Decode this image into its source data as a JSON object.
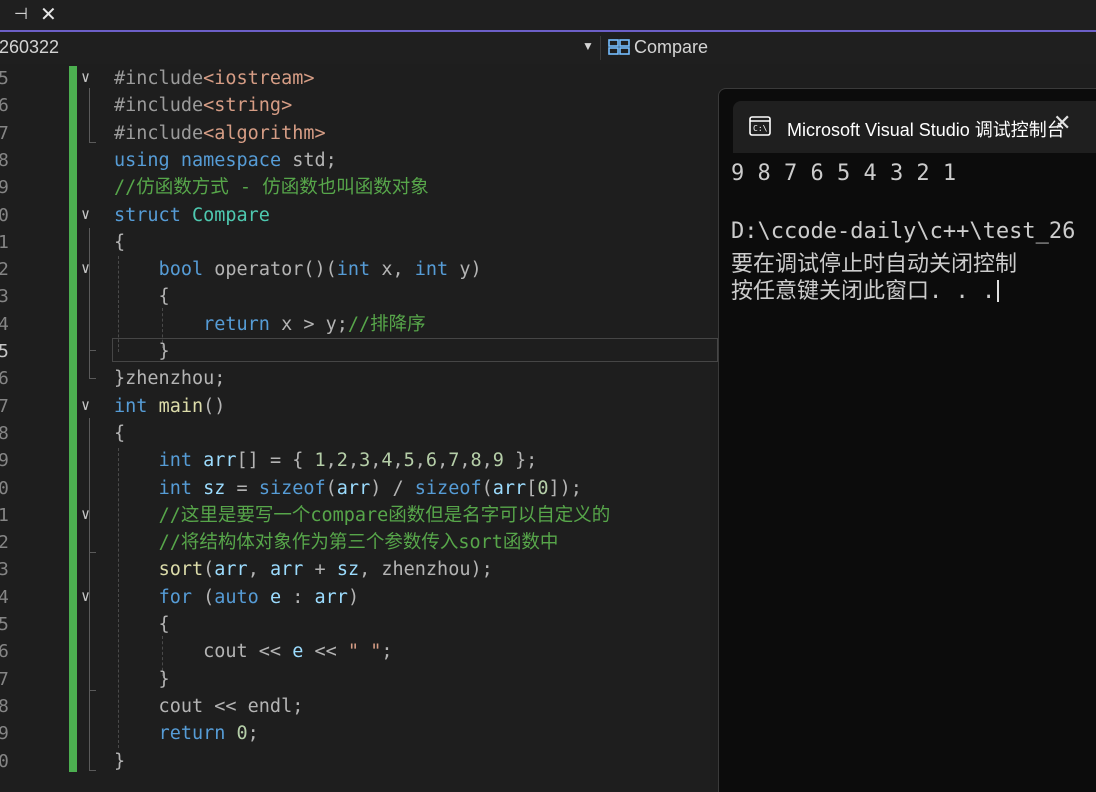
{
  "tabbar": {
    "pin_icon": "pin-icon",
    "close_icon": "close-icon"
  },
  "nav": {
    "left_text": "260322",
    "right_text": "Compare"
  },
  "lines": [
    {
      "n": "5",
      "parts": [
        [
          "pp",
          "#include"
        ],
        [
          "str",
          "<iostream>"
        ]
      ]
    },
    {
      "n": "6",
      "parts": [
        [
          "pp",
          "#include"
        ],
        [
          "str",
          "<string>"
        ]
      ]
    },
    {
      "n": "7",
      "parts": [
        [
          "pp",
          "#include"
        ],
        [
          "str",
          "<algorithm>"
        ]
      ]
    },
    {
      "n": "8",
      "parts": [
        [
          "kw",
          "using"
        ],
        [
          "op",
          " "
        ],
        [
          "kw",
          "namespace"
        ],
        [
          "op",
          " std;"
        ]
      ]
    },
    {
      "n": "9",
      "parts": [
        [
          "cm",
          "//仿函数方式 - 仿函数也叫函数对象"
        ]
      ]
    },
    {
      "n": "0",
      "parts": [
        [
          "kw",
          "struct"
        ],
        [
          "op",
          " "
        ],
        [
          "ty",
          "Compare"
        ]
      ]
    },
    {
      "n": "1",
      "parts": [
        [
          "op",
          "{"
        ]
      ]
    },
    {
      "n": "2",
      "parts": [
        [
          "op",
          "    "
        ],
        [
          "kw",
          "bool"
        ],
        [
          "op",
          " operator()("
        ],
        [
          "kw",
          "int"
        ],
        [
          "op",
          " x, "
        ],
        [
          "kw",
          "int"
        ],
        [
          "op",
          " y)"
        ]
      ]
    },
    {
      "n": "3",
      "parts": [
        [
          "op",
          "    {"
        ]
      ]
    },
    {
      "n": "4",
      "parts": [
        [
          "op",
          "        "
        ],
        [
          "kw",
          "return"
        ],
        [
          "op",
          " x > y;"
        ],
        [
          "cm",
          "//排降序"
        ]
      ]
    },
    {
      "n": "5",
      "parts": [
        [
          "op",
          "    }"
        ]
      ]
    },
    {
      "n": "6",
      "parts": [
        [
          "op",
          "}zhenzhou;"
        ]
      ]
    },
    {
      "n": "7",
      "parts": [
        [
          "kw",
          "int"
        ],
        [
          "op",
          " "
        ],
        [
          "fn",
          "main"
        ],
        [
          "op",
          "()"
        ]
      ]
    },
    {
      "n": "8",
      "parts": [
        [
          "op",
          "{"
        ]
      ]
    },
    {
      "n": "9",
      "parts": [
        [
          "op",
          "    "
        ],
        [
          "kw",
          "int"
        ],
        [
          "op",
          " "
        ],
        [
          "var",
          "arr"
        ],
        [
          "op",
          "[] = { "
        ],
        [
          "num",
          "1"
        ],
        [
          "op",
          ","
        ],
        [
          "num",
          "2"
        ],
        [
          "op",
          ","
        ],
        [
          "num",
          "3"
        ],
        [
          "op",
          ","
        ],
        [
          "num",
          "4"
        ],
        [
          "op",
          ","
        ],
        [
          "num",
          "5"
        ],
        [
          "op",
          ","
        ],
        [
          "num",
          "6"
        ],
        [
          "op",
          ","
        ],
        [
          "num",
          "7"
        ],
        [
          "op",
          ","
        ],
        [
          "num",
          "8"
        ],
        [
          "op",
          ","
        ],
        [
          "num",
          "9"
        ],
        [
          "op",
          " };"
        ]
      ]
    },
    {
      "n": "0",
      "parts": [
        [
          "op",
          "    "
        ],
        [
          "kw",
          "int"
        ],
        [
          "op",
          " "
        ],
        [
          "var",
          "sz"
        ],
        [
          "op",
          " = "
        ],
        [
          "kw",
          "sizeof"
        ],
        [
          "op",
          "("
        ],
        [
          "var",
          "arr"
        ],
        [
          "op",
          ") / "
        ],
        [
          "kw",
          "sizeof"
        ],
        [
          "op",
          "("
        ],
        [
          "var",
          "arr"
        ],
        [
          "op",
          "["
        ],
        [
          "num",
          "0"
        ],
        [
          "op",
          "]);"
        ]
      ]
    },
    {
      "n": "1",
      "parts": [
        [
          "op",
          "    "
        ],
        [
          "cm",
          "//这里是要写一个compare函数但是名字可以自定义的"
        ]
      ]
    },
    {
      "n": "2",
      "parts": [
        [
          "op",
          "    "
        ],
        [
          "cm",
          "//将结构体对象作为第三个参数传入sort函数中"
        ]
      ]
    },
    {
      "n": "3",
      "parts": [
        [
          "op",
          "    "
        ],
        [
          "fn",
          "sort"
        ],
        [
          "op",
          "("
        ],
        [
          "var",
          "arr"
        ],
        [
          "op",
          ", "
        ],
        [
          "var",
          "arr"
        ],
        [
          "op",
          " + "
        ],
        [
          "var",
          "sz"
        ],
        [
          "op",
          ", zhenzhou);"
        ]
      ]
    },
    {
      "n": "4",
      "parts": [
        [
          "op",
          "    "
        ],
        [
          "kw",
          "for"
        ],
        [
          "op",
          " ("
        ],
        [
          "kw",
          "auto"
        ],
        [
          "op",
          " "
        ],
        [
          "var",
          "e"
        ],
        [
          "op",
          " : "
        ],
        [
          "var",
          "arr"
        ],
        [
          "op",
          ")"
        ]
      ]
    },
    {
      "n": "5",
      "parts": [
        [
          "op",
          "    {"
        ]
      ]
    },
    {
      "n": "6",
      "parts": [
        [
          "op",
          "        "
        ],
        [
          "op",
          "cout << "
        ],
        [
          "var",
          "e"
        ],
        [
          "op",
          " << "
        ],
        [
          "str",
          "\" \""
        ],
        [
          "op",
          ";"
        ]
      ]
    },
    {
      "n": "7",
      "parts": [
        [
          "op",
          "    }"
        ]
      ]
    },
    {
      "n": "8",
      "parts": [
        [
          "op",
          "    cout << endl;"
        ]
      ]
    },
    {
      "n": "9",
      "parts": [
        [
          "op",
          "    "
        ],
        [
          "kw",
          "return"
        ],
        [
          "op",
          " "
        ],
        [
          "num",
          "0"
        ],
        [
          "op",
          ";"
        ]
      ]
    },
    {
      "n": "0",
      "parts": [
        [
          "op",
          "}"
        ]
      ]
    }
  ],
  "console": {
    "title": "Microsoft Visual Studio 调试控制台",
    "output": "9 8 7 6 5 4 3 2 1",
    "path_line": "D:\\ccode-daily\\c++\\test_26",
    "msg1": "要在调试停止时自动关闭控制",
    "msg2": "按任意键关闭此窗口. . ."
  }
}
